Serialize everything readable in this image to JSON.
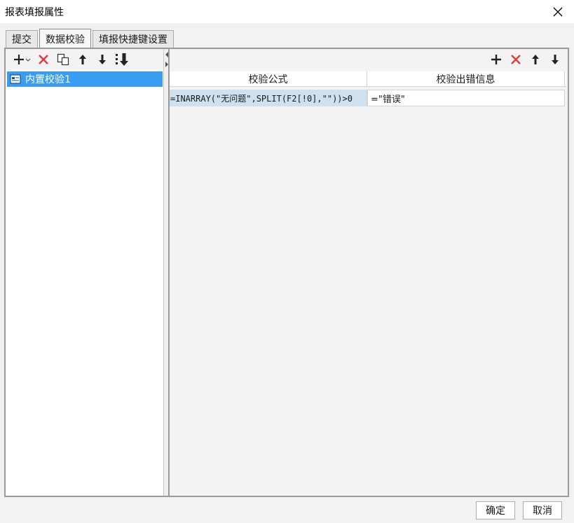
{
  "window": {
    "title": "报表填报属性"
  },
  "tabs": [
    {
      "label": "提交"
    },
    {
      "label": "数据校验"
    },
    {
      "label": "填报快捷键设置"
    }
  ],
  "left_toolbar": {
    "icons": [
      "add-dropdown-icon",
      "delete-icon",
      "copy-icon",
      "move-up-icon",
      "move-down-icon",
      "move-bottom-icon"
    ]
  },
  "tree": {
    "items": [
      {
        "label": "内置校验1"
      }
    ]
  },
  "right_toolbar": {
    "icons": [
      "add-icon",
      "delete-icon",
      "move-up-icon",
      "move-down-icon"
    ]
  },
  "grid": {
    "columns": [
      "校验公式",
      "校验出错信息"
    ],
    "rows": [
      {
        "formula": "=INARRAY(\"无问题\",SPLIT(F2[!0],\"\"))>0",
        "message": "=\"错误\""
      }
    ]
  },
  "footer": {
    "ok_label": "确定",
    "cancel_label": "取消"
  },
  "colors": {
    "selection": "#3b9df1",
    "delete_red": "#e23a3a",
    "formula_bg": "#cfe0ef"
  }
}
